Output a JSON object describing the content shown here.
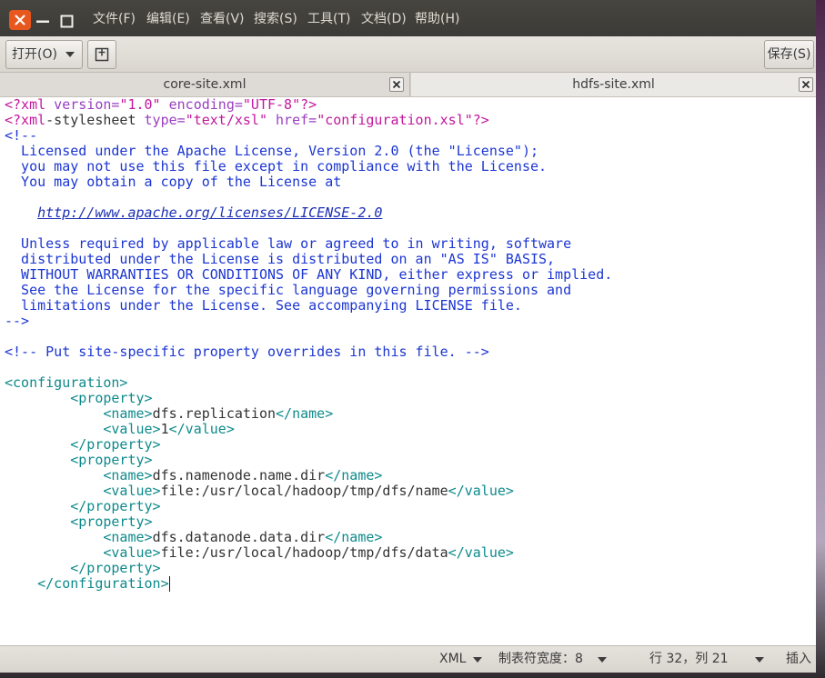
{
  "menu": [
    "文件(F)",
    "编辑(E)",
    "查看(V)",
    "搜索(S)",
    "工具(T)",
    "文档(D)",
    "帮助(H)"
  ],
  "toolbar": {
    "open_label": "打开(O)",
    "save_label": "保存(S)"
  },
  "tabs": [
    {
      "label": "core-site.xml",
      "active": false
    },
    {
      "label": "hdfs-site.xml",
      "active": true
    }
  ],
  "editor": {
    "cursor": {
      "line": 32,
      "column": 21
    },
    "lines": [
      {
        "tokens": [
          {
            "text": "<?xml",
            "color": "#c2189e"
          },
          {
            "text": " version=",
            "color": "#9a3fc0"
          },
          {
            "text": "\"1.0\"",
            "color": "#c2189e"
          },
          {
            "text": " encoding=",
            "color": "#9a3fc0"
          },
          {
            "text": "\"UTF-8\"",
            "color": "#c2189e"
          },
          {
            "text": "?>",
            "color": "#c2189e"
          }
        ]
      },
      {
        "tokens": [
          {
            "text": "<?xml",
            "color": "#c2189e"
          },
          {
            "text": "-stylesheet",
            "color": "#333333"
          },
          {
            "text": " type=",
            "color": "#9a3fc0"
          },
          {
            "text": "\"text/xsl\"",
            "color": "#c2189e"
          },
          {
            "text": " href=",
            "color": "#9a3fc0"
          },
          {
            "text": "\"configuration.xsl\"",
            "color": "#c2189e"
          },
          {
            "text": "?>",
            "color": "#c2189e"
          }
        ]
      },
      {
        "tokens": [
          {
            "text": "<!--",
            "color": "#1c36d2"
          }
        ]
      },
      {
        "tokens": [
          {
            "text": "  Licensed under the Apache License, Version 2.0 (the \"License\");",
            "color": "#1c36d2"
          }
        ]
      },
      {
        "tokens": [
          {
            "text": "  you may not use this file except in compliance with the License.",
            "color": "#1c36d2"
          }
        ]
      },
      {
        "tokens": [
          {
            "text": "  You may obtain a copy of the License at",
            "color": "#1c36d2"
          }
        ]
      },
      {
        "tokens": []
      },
      {
        "tokens": [
          {
            "text": "    ",
            "color": "#1c36d2"
          },
          {
            "text": "http://www.apache.org/licenses/LICENSE-2.0",
            "color": "#1c2fb4",
            "link": true
          }
        ]
      },
      {
        "tokens": []
      },
      {
        "tokens": [
          {
            "text": "  Unless required by applicable law or agreed to in writing, software",
            "color": "#1c36d2"
          }
        ]
      },
      {
        "tokens": [
          {
            "text": "  distributed under the License is distributed on an \"AS IS\" BASIS,",
            "color": "#1c36d2"
          }
        ]
      },
      {
        "tokens": [
          {
            "text": "  WITHOUT WARRANTIES OR CONDITIONS OF ANY KIND, either express or implied.",
            "color": "#1c36d2"
          }
        ]
      },
      {
        "tokens": [
          {
            "text": "  See the License for the specific language governing permissions and",
            "color": "#1c36d2"
          }
        ]
      },
      {
        "tokens": [
          {
            "text": "  limitations under the License. See accompanying LICENSE file.",
            "color": "#1c36d2"
          }
        ]
      },
      {
        "tokens": [
          {
            "text": "-->",
            "color": "#1c36d2"
          }
        ]
      },
      {
        "tokens": []
      },
      {
        "tokens": [
          {
            "text": "<!-- Put site-specific property overrides in this file. -->",
            "color": "#1c36d2"
          }
        ]
      },
      {
        "tokens": []
      },
      {
        "tokens": [
          {
            "text": "<configuration>",
            "color": "#0e8a8c"
          }
        ]
      },
      {
        "tokens": [
          {
            "text": "        <property>",
            "color": "#0e8a8c"
          }
        ]
      },
      {
        "tokens": [
          {
            "text": "            <name>",
            "color": "#0e8a8c"
          },
          {
            "text": "dfs.replication",
            "color": "#333333"
          },
          {
            "text": "</name>",
            "color": "#0e8a8c"
          }
        ]
      },
      {
        "tokens": [
          {
            "text": "            <value>",
            "color": "#0e8a8c"
          },
          {
            "text": "1",
            "color": "#333333"
          },
          {
            "text": "</value>",
            "color": "#0e8a8c"
          }
        ]
      },
      {
        "tokens": [
          {
            "text": "        </property>",
            "color": "#0e8a8c"
          }
        ]
      },
      {
        "tokens": [
          {
            "text": "        <property>",
            "color": "#0e8a8c"
          }
        ]
      },
      {
        "tokens": [
          {
            "text": "            <name>",
            "color": "#0e8a8c"
          },
          {
            "text": "dfs.namenode.name.dir",
            "color": "#333333"
          },
          {
            "text": "</name>",
            "color": "#0e8a8c"
          }
        ]
      },
      {
        "tokens": [
          {
            "text": "            <value>",
            "color": "#0e8a8c"
          },
          {
            "text": "file:/usr/local/hadoop/tmp/dfs/name",
            "color": "#333333"
          },
          {
            "text": "</value>",
            "color": "#0e8a8c"
          }
        ]
      },
      {
        "tokens": [
          {
            "text": "        </property>",
            "color": "#0e8a8c"
          }
        ]
      },
      {
        "tokens": [
          {
            "text": "        <property>",
            "color": "#0e8a8c"
          }
        ]
      },
      {
        "tokens": [
          {
            "text": "            <name>",
            "color": "#0e8a8c"
          },
          {
            "text": "dfs.datanode.data.dir",
            "color": "#333333"
          },
          {
            "text": "</name>",
            "color": "#0e8a8c"
          }
        ]
      },
      {
        "tokens": [
          {
            "text": "            <value>",
            "color": "#0e8a8c"
          },
          {
            "text": "file:/usr/local/hadoop/tmp/dfs/data",
            "color": "#333333"
          },
          {
            "text": "</value>",
            "color": "#0e8a8c"
          }
        ]
      },
      {
        "tokens": [
          {
            "text": "        </property>",
            "color": "#0e8a8c"
          }
        ]
      },
      {
        "tokens": [
          {
            "text": "    </configuration>",
            "color": "#0e8a8c"
          }
        ]
      }
    ]
  },
  "statusbar": {
    "language": "XML",
    "tab_width": "制表符宽度：8",
    "position": "行 32，列 21",
    "mode": "插入"
  },
  "icons": {
    "window_close": "close-icon",
    "window_minimize": "minimize-icon",
    "window_maximize": "maximize-icon",
    "open_dropdown": "chevron-down-icon",
    "new_document": "new-document-icon",
    "tab_close": "close-icon",
    "status_dropdown": "chevron-down-icon"
  },
  "colors": {
    "titlebar": "#3c3b37",
    "close_button": "#e8571e",
    "menu_text": "#dfdbd2",
    "toolbar": "#dad6cf",
    "editor_background": "#ffffff"
  }
}
